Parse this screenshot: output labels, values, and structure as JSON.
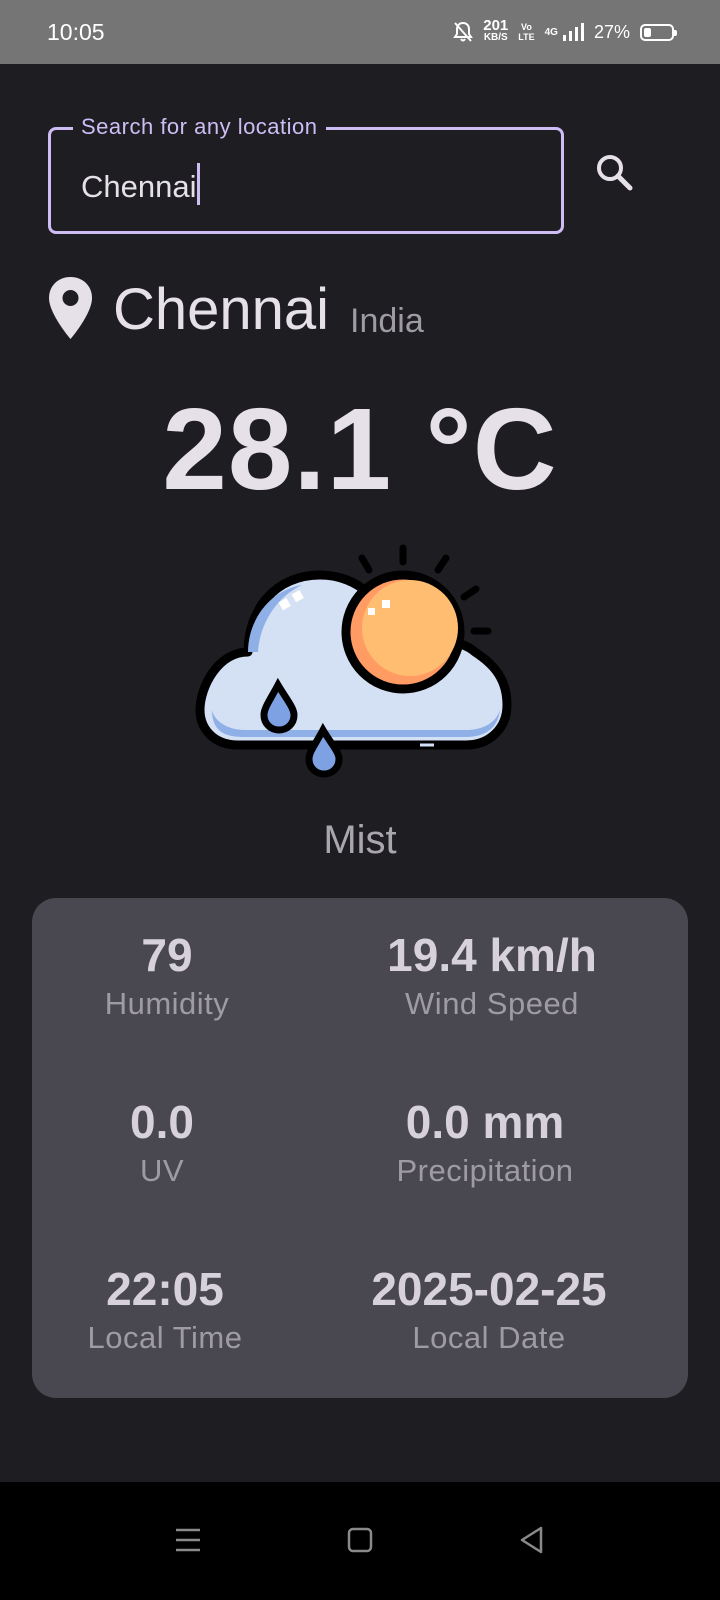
{
  "status_bar": {
    "time": "10:05",
    "net_speed_value": "201",
    "net_speed_unit": "KB/S",
    "volte_top": "Vo",
    "volte_bottom": "LTE",
    "network": "4G",
    "battery_percent": "27%",
    "battery_level": 0.27,
    "icons": [
      "mute-icon",
      "signal-icon",
      "battery-icon"
    ]
  },
  "search": {
    "label": "Search for any location",
    "value": "Chennai",
    "accent_color": "#cdbdf4",
    "icon": "search-icon"
  },
  "location": {
    "city": "Chennai",
    "country": "India",
    "icon": "location-pin-icon"
  },
  "weather": {
    "temperature": "28.1 °C",
    "condition": "Mist",
    "icon": "cloud-sun-rain-icon"
  },
  "stats": {
    "humidity": {
      "value": "79",
      "label": "Humidity"
    },
    "wind_speed": {
      "value": "19.4 km/h",
      "label": "Wind Speed"
    },
    "uv": {
      "value": "0.0",
      "label": "UV"
    },
    "precipitation": {
      "value": "0.0 mm",
      "label": "Precipitation"
    },
    "local_time": {
      "value": "22:05",
      "label": "Local Time"
    },
    "local_date": {
      "value": "2025-02-25",
      "label": "Local Date"
    }
  },
  "nav_bar": {
    "icons": [
      "menu-icon",
      "home-icon",
      "back-icon"
    ]
  },
  "colors": {
    "background": "#1e1d22",
    "card": "#49474f",
    "status_bar": "#757575",
    "sun": "#ffbd72",
    "cloud": "#d4e1f4"
  }
}
